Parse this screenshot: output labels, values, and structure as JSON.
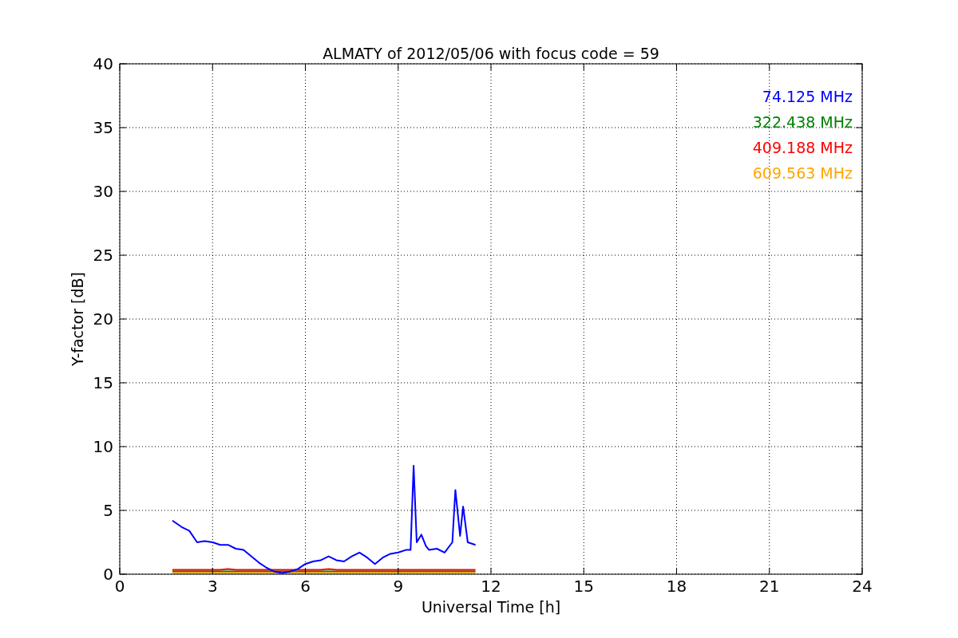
{
  "chart_data": {
    "type": "line",
    "title": "ALMATY of 2012/05/06 with focus code = 59",
    "xlabel": "Universal Time [h]",
    "ylabel": "Y-factor [dB]",
    "x": [
      1.7,
      2,
      2.25,
      2.5,
      2.75,
      3,
      3.25,
      3.5,
      3.75,
      4,
      4.25,
      4.5,
      4.75,
      5,
      5.25,
      5.5,
      5.75,
      6,
      6.25,
      6.5,
      6.75,
      7,
      7.25,
      7.5,
      7.75,
      8,
      8.25,
      8.5,
      8.75,
      9,
      9.25,
      9.4,
      9.5,
      9.6,
      9.75,
      9.9,
      10,
      10.25,
      10.5,
      10.75,
      10.85,
      11,
      11.1,
      11.25,
      11.5
    ],
    "series": [
      {
        "name": "74.125 MHz",
        "color": "#0000ff",
        "values": [
          4.2,
          3.7,
          3.4,
          2.5,
          2.6,
          2.5,
          2.3,
          2.3,
          2.0,
          1.9,
          1.4,
          0.9,
          0.5,
          0.2,
          0.1,
          0.2,
          0.4,
          0.8,
          1.0,
          1.1,
          1.4,
          1.1,
          1.0,
          1.4,
          1.7,
          1.3,
          0.8,
          1.3,
          1.6,
          1.7,
          1.9,
          1.9,
          8.5,
          2.5,
          3.1,
          2.2,
          1.9,
          2.0,
          1.7,
          2.5,
          6.6,
          3.0,
          5.3,
          2.5,
          2.3
        ]
      },
      {
        "name": "322.438 MHz",
        "color": "#008000",
        "values": [
          0.22,
          0.22,
          0.22,
          0.22,
          0.22,
          0.22,
          0.22,
          0.22,
          0.22,
          0.22,
          0.22,
          0.22,
          0.22,
          0.22,
          0.22,
          0.22,
          0.22,
          0.22,
          0.22,
          0.22,
          0.22,
          0.22,
          0.22,
          0.22,
          0.22,
          0.22,
          0.22,
          0.22,
          0.22,
          0.22,
          0.22,
          0.22,
          0.22,
          0.22,
          0.22,
          0.22,
          0.22,
          0.22,
          0.22,
          0.22,
          0.22,
          0.22,
          0.22,
          0.22,
          0.22
        ]
      },
      {
        "name": "409.188 MHz",
        "color": "#ff0000",
        "values": [
          0.35,
          0.35,
          0.35,
          0.35,
          0.35,
          0.35,
          0.35,
          0.4,
          0.35,
          0.35,
          0.35,
          0.35,
          0.35,
          0.35,
          0.35,
          0.35,
          0.35,
          0.35,
          0.35,
          0.35,
          0.4,
          0.35,
          0.35,
          0.35,
          0.35,
          0.35,
          0.35,
          0.35,
          0.35,
          0.35,
          0.35,
          0.35,
          0.35,
          0.35,
          0.35,
          0.35,
          0.35,
          0.35,
          0.35,
          0.35,
          0.35,
          0.35,
          0.35,
          0.35,
          0.35
        ]
      },
      {
        "name": "609.563 MHz",
        "color": "#ffa500",
        "values": [
          0.1,
          0.1,
          0.1,
          0.1,
          0.1,
          0.1,
          0.1,
          0.1,
          0.1,
          0.1,
          0.1,
          0.1,
          0.1,
          0.1,
          0.1,
          0.1,
          0.1,
          0.1,
          0.1,
          0.1,
          0.1,
          0.1,
          0.1,
          0.1,
          0.1,
          0.1,
          0.1,
          0.1,
          0.1,
          0.1,
          0.1,
          0.1,
          0.1,
          0.1,
          0.1,
          0.1,
          0.1,
          0.1,
          0.1,
          0.1,
          0.1,
          0.1,
          0.1,
          0.1,
          0.1
        ]
      }
    ],
    "grid": true,
    "xlim": [
      0,
      24
    ],
    "ylim": [
      0,
      40
    ],
    "xticks": [
      0,
      3,
      6,
      9,
      12,
      15,
      18,
      21,
      24
    ],
    "yticks": [
      0,
      5,
      10,
      15,
      20,
      25,
      30,
      35,
      40
    ]
  }
}
